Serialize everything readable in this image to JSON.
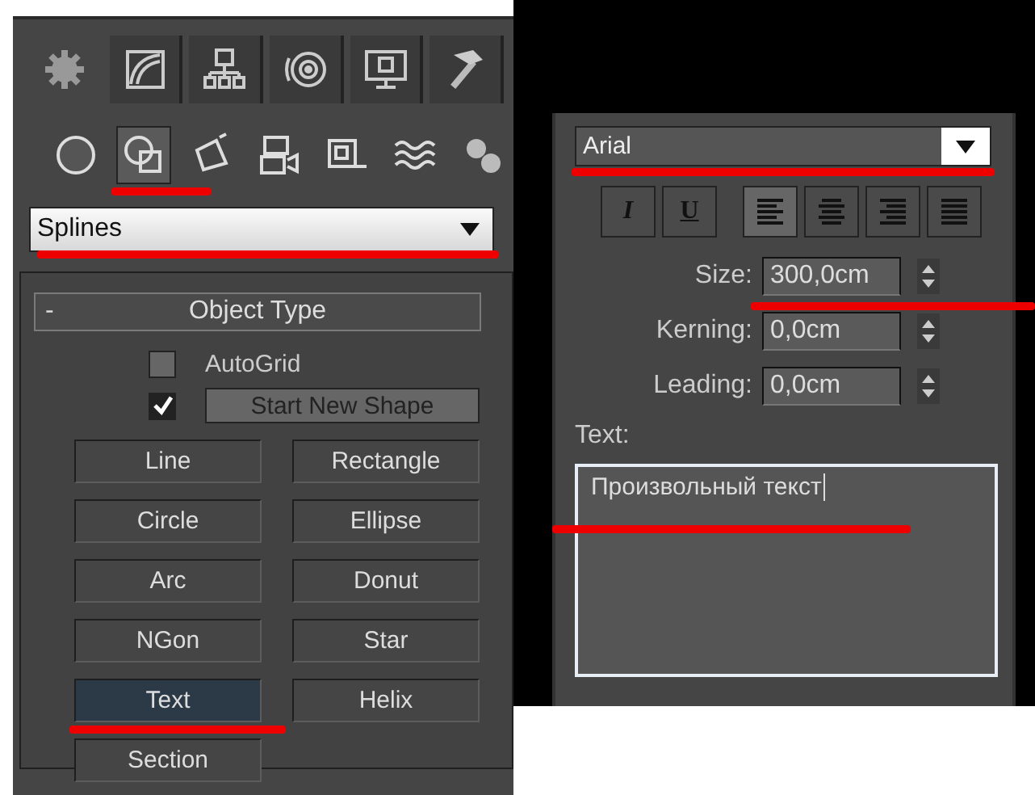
{
  "command_tabs": [
    {
      "selected": true
    },
    {
      "selected": false
    },
    {
      "selected": false
    },
    {
      "selected": false
    },
    {
      "selected": false
    },
    {
      "selected": false
    }
  ],
  "category_icons": [
    {
      "selected": false,
      "highlighted": false
    },
    {
      "selected": true,
      "highlighted": true
    },
    {
      "selected": false,
      "highlighted": false
    },
    {
      "selected": false,
      "highlighted": false
    },
    {
      "selected": false,
      "highlighted": false
    },
    {
      "selected": false,
      "highlighted": false
    },
    {
      "selected": false,
      "highlighted": false
    }
  ],
  "category_dropdown": {
    "value": "Splines",
    "highlighted": true
  },
  "rollout": {
    "toggle": "-",
    "title": "Object Type"
  },
  "autogrid": {
    "label": "AutoGrid",
    "checked": false
  },
  "start_new_shape": {
    "label": "Start New Shape",
    "checked": true
  },
  "object_buttons": [
    {
      "label": "Line",
      "selected": false,
      "highlighted": false
    },
    {
      "label": "Rectangle",
      "selected": false,
      "highlighted": false
    },
    {
      "label": "Circle",
      "selected": false,
      "highlighted": false
    },
    {
      "label": "Ellipse",
      "selected": false,
      "highlighted": false
    },
    {
      "label": "Arc",
      "selected": false,
      "highlighted": false
    },
    {
      "label": "Donut",
      "selected": false,
      "highlighted": false
    },
    {
      "label": "NGon",
      "selected": false,
      "highlighted": false
    },
    {
      "label": "Star",
      "selected": false,
      "highlighted": false
    },
    {
      "label": "Text",
      "selected": true,
      "highlighted": true
    },
    {
      "label": "Helix",
      "selected": false,
      "highlighted": false
    },
    {
      "label": "Section",
      "selected": false,
      "highlighted": false
    }
  ],
  "font_dropdown": {
    "value": "Arial",
    "highlighted": true
  },
  "style_buttons": [
    {
      "kind": "italic",
      "label": "I",
      "selected": false
    },
    {
      "kind": "underline",
      "label": "U",
      "selected": false
    },
    {
      "kind": "align-left",
      "selected": true
    },
    {
      "kind": "align-center",
      "selected": false
    },
    {
      "kind": "align-right",
      "selected": false
    },
    {
      "kind": "justify",
      "selected": false
    }
  ],
  "params": [
    {
      "label": "Size:",
      "value": "300,0cm",
      "highlighted": true
    },
    {
      "label": "Kerning:",
      "value": "0,0cm",
      "highlighted": false
    },
    {
      "label": "Leading:",
      "value": "0,0cm",
      "highlighted": false
    }
  ],
  "text_label": "Text:",
  "text_field": {
    "value": "Произвольный текст",
    "highlighted": true
  }
}
